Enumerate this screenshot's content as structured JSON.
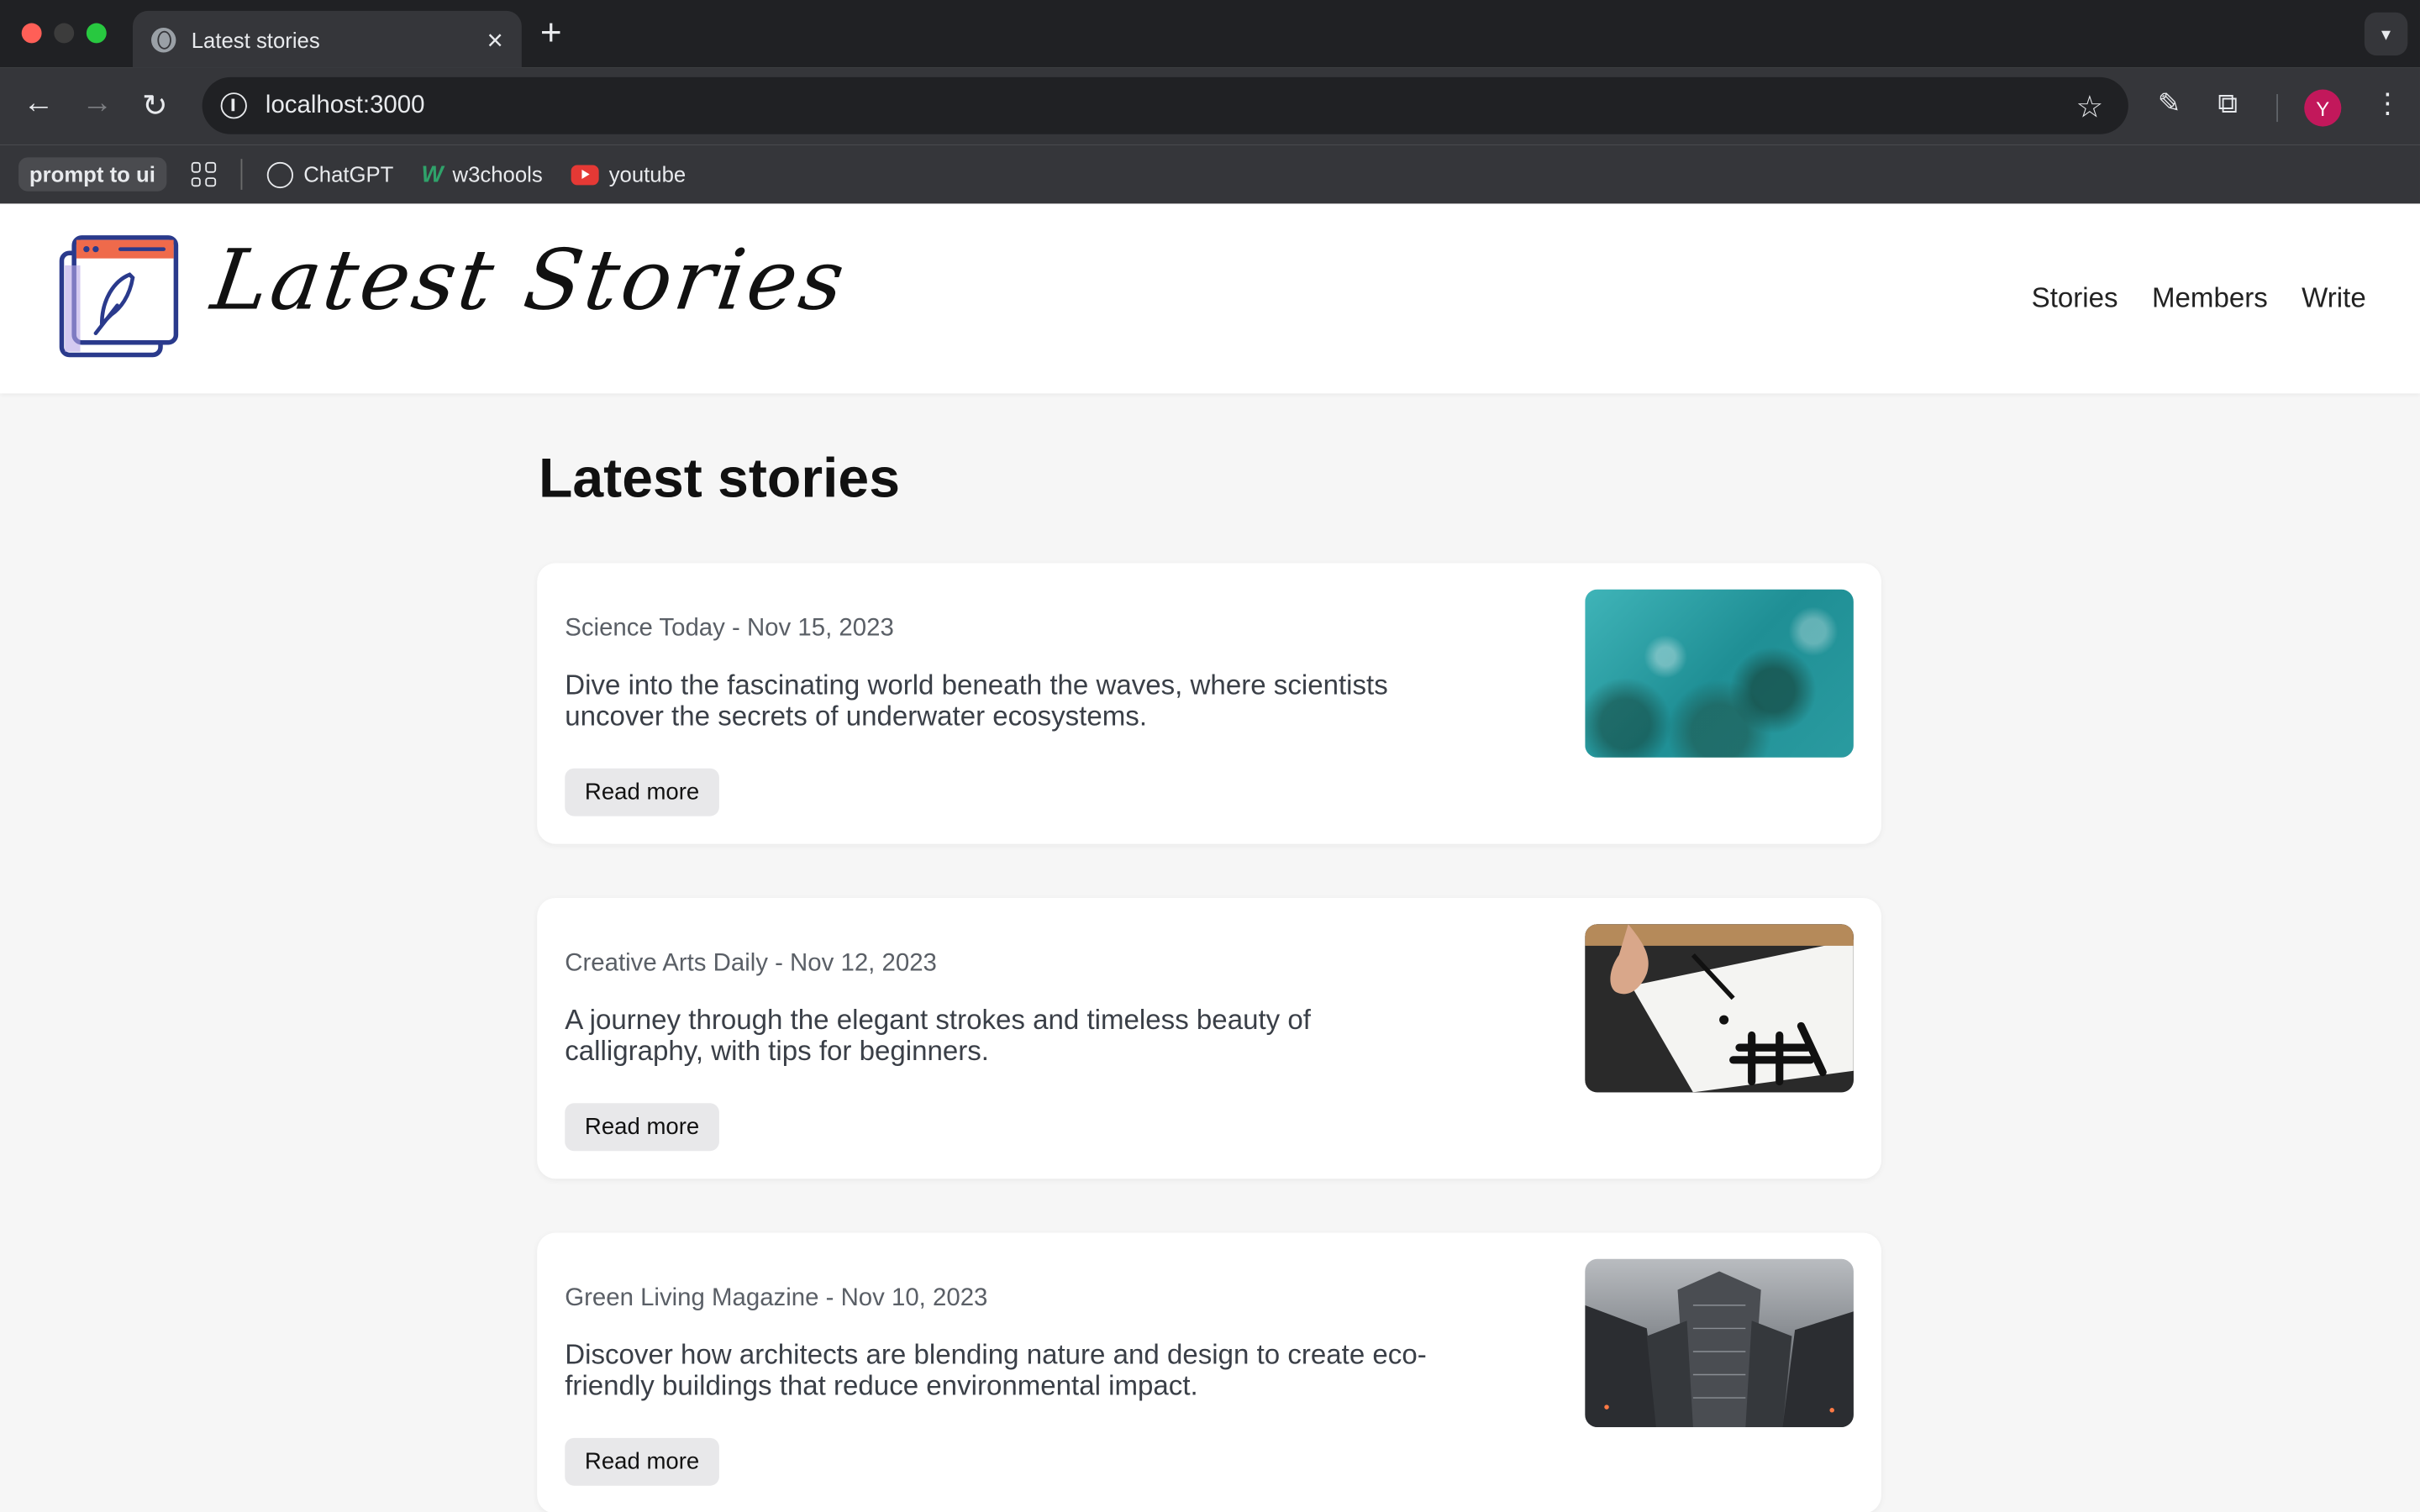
{
  "browser": {
    "tab_title": "Latest stories",
    "tab_close": "×",
    "new_tab": "+",
    "url": "localhost:3000",
    "avatar_letter": "Y",
    "bookmarks": {
      "pill": "prompt to ui",
      "items": [
        "ChatGPT",
        "w3chools",
        "youtube"
      ]
    }
  },
  "header": {
    "logo_text": "Latest Stories",
    "nav": [
      "Stories",
      "Members",
      "Write"
    ]
  },
  "page": {
    "title": "Latest stories",
    "stories": [
      {
        "meta": "Science Today - Nov 15, 2023",
        "excerpt": "Dive into the fascinating world beneath the waves, where scientists uncover the secrets of underwater ecosystems.",
        "button": "Read more"
      },
      {
        "meta": "Creative Arts Daily - Nov 12, 2023",
        "excerpt": "A journey through the elegant strokes and timeless beauty of calligraphy, with tips for beginners.",
        "button": "Read more"
      },
      {
        "meta": "Green Living Magazine - Nov 10, 2023",
        "excerpt": "Discover how architects are blending nature and design to create eco-friendly buildings that reduce environmental impact.",
        "button": "Read more"
      }
    ]
  },
  "colors": {
    "accent": "#ef6a4b",
    "logo_blue": "#2a3a8c"
  }
}
